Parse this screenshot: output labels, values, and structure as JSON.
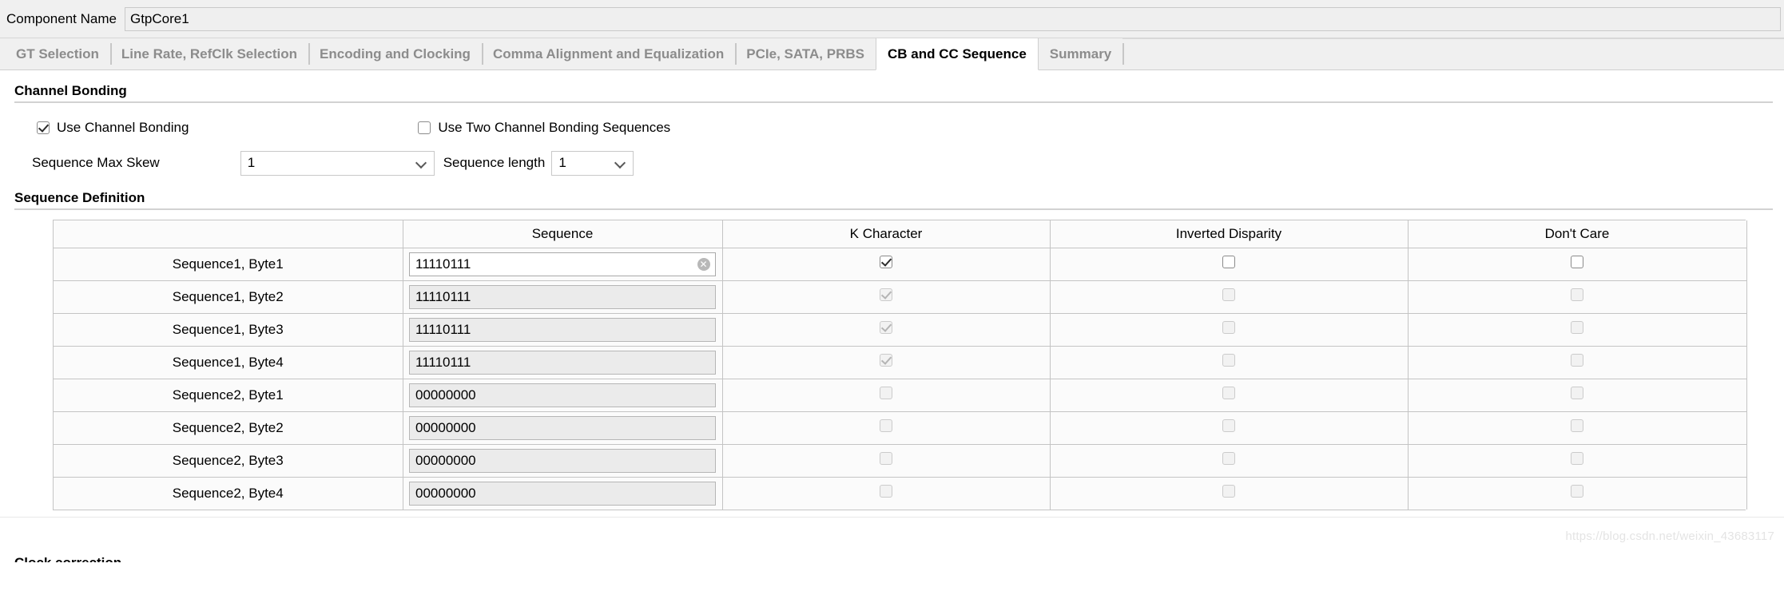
{
  "component": {
    "label": "Component Name",
    "value": "GtpCore1"
  },
  "tabs": [
    {
      "label": "GT Selection",
      "active": false
    },
    {
      "label": "Line Rate, RefClk Selection",
      "active": false
    },
    {
      "label": "Encoding and Clocking",
      "active": false
    },
    {
      "label": "Comma Alignment and Equalization",
      "active": false
    },
    {
      "label": "PCIe, SATA, PRBS",
      "active": false
    },
    {
      "label": "CB and CC Sequence",
      "active": true
    },
    {
      "label": "Summary",
      "active": false
    }
  ],
  "channel_bonding": {
    "section_title": "Channel Bonding",
    "use_channel_bonding": {
      "label": "Use Channel Bonding",
      "checked": true
    },
    "use_two_sequences": {
      "label": "Use Two Channel Bonding Sequences",
      "checked": false
    },
    "sequence_max_skew": {
      "label": "Sequence Max Skew",
      "value": "1"
    },
    "sequence_length": {
      "label": "Sequence length",
      "value": "1"
    }
  },
  "sequence_definition": {
    "section_title": "Sequence Definition",
    "columns": [
      "",
      "Sequence",
      "K Character",
      "Inverted Disparity",
      "Don't Care"
    ],
    "rows": [
      {
        "name": "Sequence1, Byte1",
        "sequence": "11110111",
        "enabled": true,
        "show_clear": true,
        "k_character": true,
        "inverted_disparity": false,
        "dont_care": false
      },
      {
        "name": "Sequence1, Byte2",
        "sequence": "11110111",
        "enabled": false,
        "show_clear": false,
        "k_character": true,
        "inverted_disparity": false,
        "dont_care": false
      },
      {
        "name": "Sequence1, Byte3",
        "sequence": "11110111",
        "enabled": false,
        "show_clear": false,
        "k_character": true,
        "inverted_disparity": false,
        "dont_care": false
      },
      {
        "name": "Sequence1, Byte4",
        "sequence": "11110111",
        "enabled": false,
        "show_clear": false,
        "k_character": true,
        "inverted_disparity": false,
        "dont_care": false
      },
      {
        "name": "Sequence2, Byte1",
        "sequence": "00000000",
        "enabled": false,
        "show_clear": false,
        "k_character": false,
        "inverted_disparity": false,
        "dont_care": false
      },
      {
        "name": "Sequence2, Byte2",
        "sequence": "00000000",
        "enabled": false,
        "show_clear": false,
        "k_character": false,
        "inverted_disparity": false,
        "dont_care": false
      },
      {
        "name": "Sequence2, Byte3",
        "sequence": "00000000",
        "enabled": false,
        "show_clear": false,
        "k_character": false,
        "inverted_disparity": false,
        "dont_care": false
      },
      {
        "name": "Sequence2, Byte4",
        "sequence": "00000000",
        "enabled": false,
        "show_clear": false,
        "k_character": false,
        "inverted_disparity": false,
        "dont_care": false
      }
    ],
    "clear_icon_glyph": "✕"
  },
  "bottom": {
    "partial_section_title": "Clock correction",
    "watermark": "https://blog.csdn.net/weixin_43683117"
  }
}
